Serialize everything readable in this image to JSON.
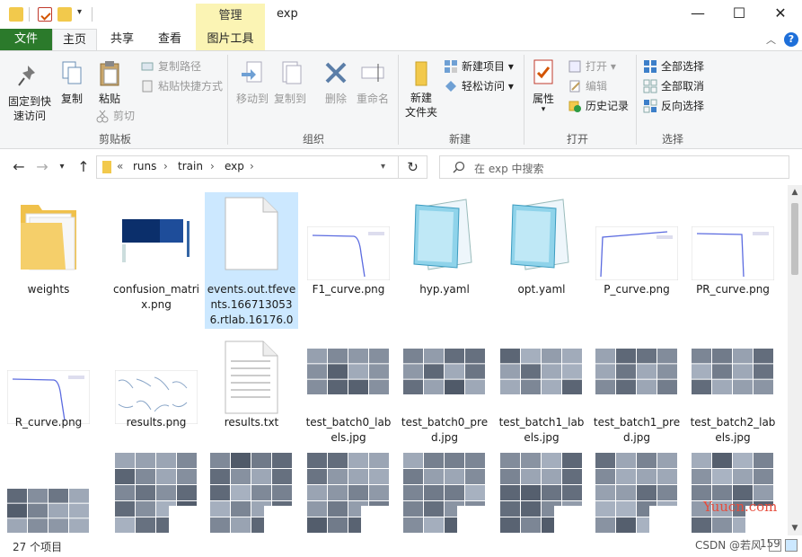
{
  "window": {
    "title": "exp",
    "context_tab": "管理",
    "controls": {
      "minimize": "—",
      "maximize": "☐",
      "close": "✕"
    }
  },
  "ribbon_tabs": [
    {
      "label": "文件"
    },
    {
      "label": "主页"
    },
    {
      "label": "共享"
    },
    {
      "label": "查看"
    },
    {
      "label": "图片工具"
    }
  ],
  "ribbon": {
    "clipboard": {
      "group_label": "剪贴板",
      "pin": "固定到快\n速访问",
      "copy": "复制",
      "paste": "粘贴",
      "copy_path": "复制路径",
      "paste_shortcut": "粘贴快捷方式",
      "cut": "剪切"
    },
    "organize": {
      "group_label": "组织",
      "move_to": "移动到",
      "copy_to": "复制到",
      "delete": "删除",
      "rename": "重命名"
    },
    "new": {
      "group_label": "新建",
      "new_folder": "新建\n文件夹",
      "new_item": "新建项目",
      "easy_access": "轻松访问"
    },
    "open": {
      "group_label": "打开",
      "properties": "属性",
      "open": "打开",
      "edit": "编辑",
      "history": "历史记录"
    },
    "select": {
      "group_label": "选择",
      "select_all": "全部选择",
      "select_none": "全部取消",
      "invert": "反向选择"
    }
  },
  "address": {
    "overflow": "«",
    "segments": [
      "runs",
      "train",
      "exp"
    ],
    "search_placeholder": "在 exp 中搜索"
  },
  "files": [
    {
      "name": "weights",
      "kind": "folder"
    },
    {
      "name": "confusion_matrix.png",
      "kind": "confusion"
    },
    {
      "name": "events.out.tfevents.1667130536.rtlab.16176.0",
      "kind": "blank",
      "selected": true
    },
    {
      "name": "F1_curve.png",
      "kind": "curve-drop"
    },
    {
      "name": "hyp.yaml",
      "kind": "notepad"
    },
    {
      "name": "opt.yaml",
      "kind": "notepad"
    },
    {
      "name": "P_curve.png",
      "kind": "curve-flat"
    },
    {
      "name": "PR_curve.png",
      "kind": "curve-pr"
    },
    {
      "name": "R_curve.png",
      "kind": "curve-drop"
    },
    {
      "name": "results.png",
      "kind": "results"
    },
    {
      "name": "results.txt",
      "kind": "text"
    },
    {
      "name": "test_batch0_labels.jpg",
      "kind": "mosaic"
    },
    {
      "name": "test_batch0_pred.jpg",
      "kind": "mosaic"
    },
    {
      "name": "test_batch1_labels.jpg",
      "kind": "mosaic"
    },
    {
      "name": "test_batch1_pred.jpg",
      "kind": "mosaic"
    },
    {
      "name": "test_batch2_labels.jpg",
      "kind": "mosaic"
    },
    {
      "name": "",
      "kind": "mosaic-short"
    },
    {
      "name": "",
      "kind": "mosaic-tall"
    },
    {
      "name": "",
      "kind": "mosaic-tall"
    },
    {
      "name": "",
      "kind": "mosaic-tall"
    },
    {
      "name": "",
      "kind": "mosaic-tall"
    },
    {
      "name": "",
      "kind": "mosaic-tall"
    },
    {
      "name": "",
      "kind": "mosaic-tall"
    },
    {
      "name": "",
      "kind": "mosaic-tall"
    }
  ],
  "status": {
    "item_count": "27 个项目",
    "selected_info": "159"
  },
  "watermarks": {
    "site": "Yuucn.com",
    "csdn": "CSDN @若风"
  },
  "colors": {
    "file_tab": "#2b7a2b",
    "context_tab": "#fbf4b4",
    "selection": "#cce8ff",
    "folder": "#f2c94c"
  }
}
